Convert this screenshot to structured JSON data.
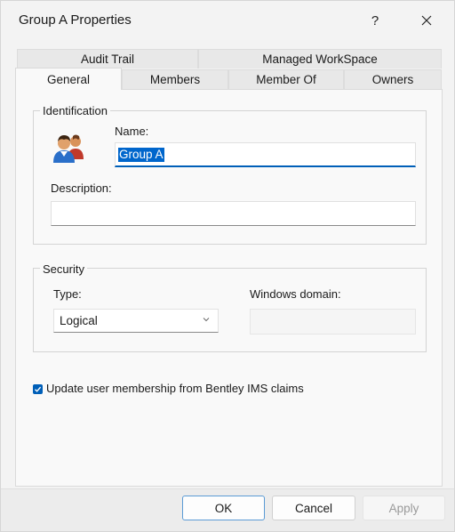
{
  "window": {
    "title": "Group A Properties",
    "help_label": "?"
  },
  "tabs": {
    "back_row": [
      "Audit Trail",
      "Managed WorkSpace"
    ],
    "front_row": [
      "General",
      "Members",
      "Member Of",
      "Owners"
    ],
    "active": "General"
  },
  "identification": {
    "group_label": "Identification",
    "name_label": "Name:",
    "name_value": "Group A",
    "description_label": "Description:",
    "description_value": ""
  },
  "security": {
    "group_label": "Security",
    "type_label": "Type:",
    "type_value": "Logical",
    "domain_label": "Windows domain:",
    "domain_value": ""
  },
  "options": {
    "update_membership_label": "Update user membership from Bentley IMS claims",
    "update_membership_checked": true
  },
  "buttons": {
    "ok": "OK",
    "cancel": "Cancel",
    "apply": "Apply"
  },
  "colors": {
    "accent": "#005fb8",
    "selection": "#0066cc"
  }
}
